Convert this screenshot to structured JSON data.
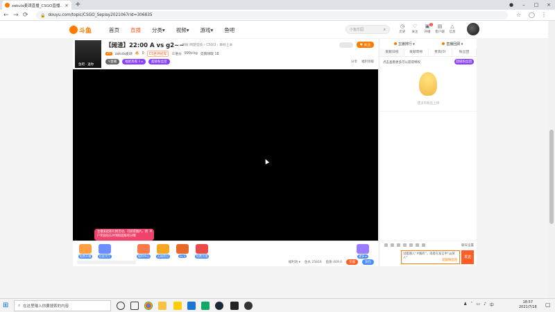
{
  "browser": {
    "tab_title": "zakula麦颂直播_CSGO直播...",
    "tab_close": "×",
    "new_tab": "+",
    "url": "douyu.com/topic/CSGO_Seplay2021067rid=306835",
    "lock": "🔒",
    "back": "←",
    "forward": "→",
    "reload": "⟳",
    "win_min": "–",
    "win_max": "□",
    "win_close": "×",
    "bookmark": "☆",
    "menu": "⋮"
  },
  "header": {
    "logo_text": "斗鱼",
    "nav": [
      "首页",
      "直播",
      "分类▾",
      "视频▾",
      "游戏▾",
      "鱼吧"
    ],
    "search_placeholder": "小鱼乐园",
    "icons": [
      {
        "label": "历史",
        "glyph": "◷"
      },
      {
        "label": "关注",
        "glyph": "♡"
      },
      {
        "label": "开播",
        "glyph": "▣"
      },
      {
        "label": "客户端",
        "glyph": "▤"
      },
      {
        "label": "信息",
        "glyph": "△"
      }
    ],
    "badge": "1"
  },
  "room": {
    "title": "【阔渣】22:00 A vs g2~~",
    "subtitle": "举报  网游竞技 › CSGO › 单标上本",
    "avatar_tag": "鱼吧 · 送你",
    "level": "25",
    "name": "zakula麦颂",
    "fans_count": "0",
    "rank": "CS世界冠军",
    "stat1": "三倍分",
    "stat2": "999+kg",
    "stat3": "竞猜领取 18",
    "pill1": "V直播",
    "pill2": "福星高照 1 ▸",
    "pill3": "超级粉丝团",
    "follow": "♥ 关注",
    "share": "分享",
    "client": "福利领取"
  },
  "popup": {
    "text": "主播发起新礼物活动，可获得图片。用户奖励钻石并领取超级积分哦",
    "close": "×"
  },
  "gifts": [
    {
      "label": "免费开播",
      "color": "#ff9f43"
    },
    {
      "label": "任务大厅",
      "color": "#6c8cff"
    },
    {
      "label": "福利中心",
      "color": "#f77b4a"
    },
    {
      "label": "天梯积分",
      "color": "#f5a623"
    },
    {
      "label": "1v.1",
      "color": "#e86a2a"
    },
    {
      "label": "免费大炮",
      "color": "#e94b4b"
    },
    {
      "label": "更多 ▸",
      "color": "#9b7bff"
    }
  ],
  "gift_bar": {
    "stat1": "福利池 ▾",
    "stat2": "鱼丸 25816",
    "stat3": "鱼翅 409.0",
    "btn1": "充值",
    "btn2": "背包"
  },
  "right_panel": {
    "top1": "主播排行 ▾",
    "top2": "直播回顾 ▾",
    "tabs": [
      "贡献日榜",
      "贡献周榜",
      "贵宾(0)",
      "粉丝团"
    ],
    "notice": "点击查看更多可以获得特权",
    "notice_btn": "超级粉丝团",
    "notice_foot": "还没有粉丝上榜",
    "tools_right": "聊天设置",
    "chat_text": "试着输入“#搬砖”，或者在发言中“@某人”",
    "chat_link": "超级粉丝团",
    "send": "发送"
  },
  "taskbar": {
    "search_placeholder": "在这里输入你要搜索的内容",
    "time": "18:57",
    "date": "2021/7/18"
  }
}
